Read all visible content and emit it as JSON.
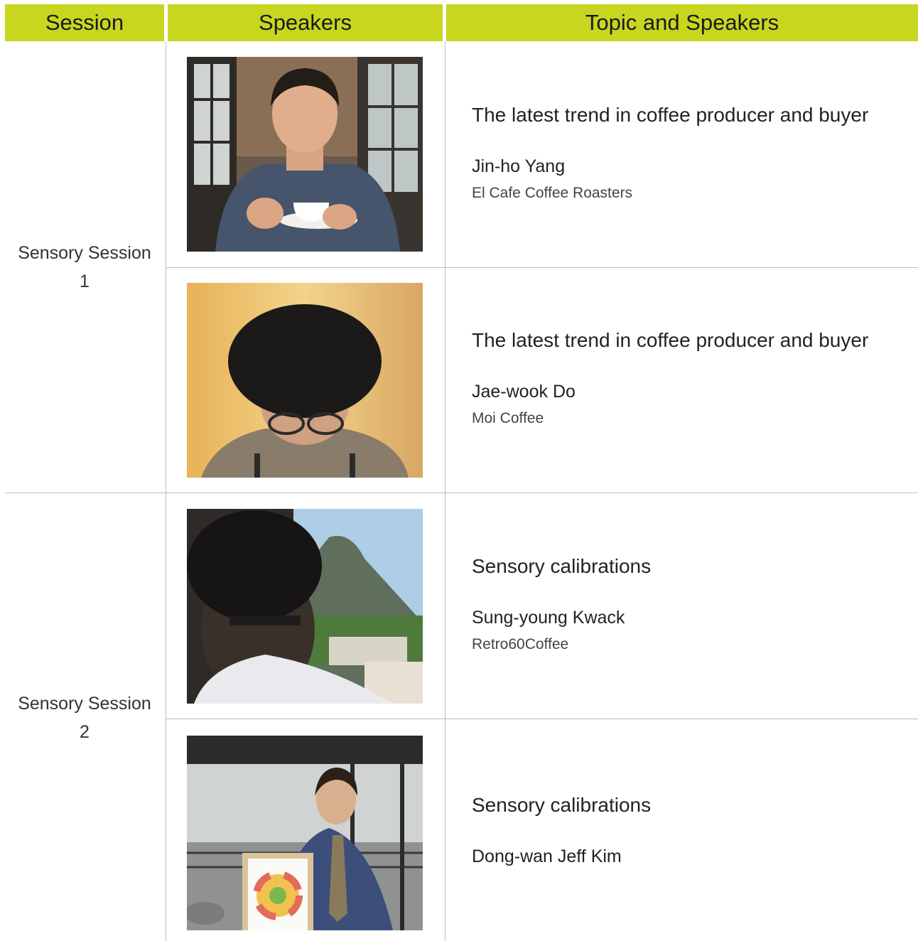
{
  "headers": {
    "session": "Session",
    "speakers": "Speakers",
    "topic_and_speakers": "Topic and Speakers"
  },
  "sessions": [
    {
      "label_line1": "Sensory Session",
      "label_line2": "1"
    },
    {
      "label_line1": "Sensory Session",
      "label_line2": "2"
    }
  ],
  "rows": [
    {
      "topic": "The latest trend in coffee producer and buyer",
      "speaker": "Jin-ho Yang",
      "organization": "El Cafe Coffee Roasters"
    },
    {
      "topic": "The latest trend in coffee producer and buyer",
      "speaker": "Jae-wook Do",
      "organization": "Moi Coffee"
    },
    {
      "topic": "Sensory calibrations",
      "speaker": "Sung-young Kwack",
      "organization": "Retro60Coffee"
    },
    {
      "topic": "Sensory calibrations",
      "speaker": "Dong-wan Jeff Kim",
      "organization": ""
    }
  ],
  "colors": {
    "header_background": "#c8d620",
    "divider": "#bdbdbd"
  }
}
